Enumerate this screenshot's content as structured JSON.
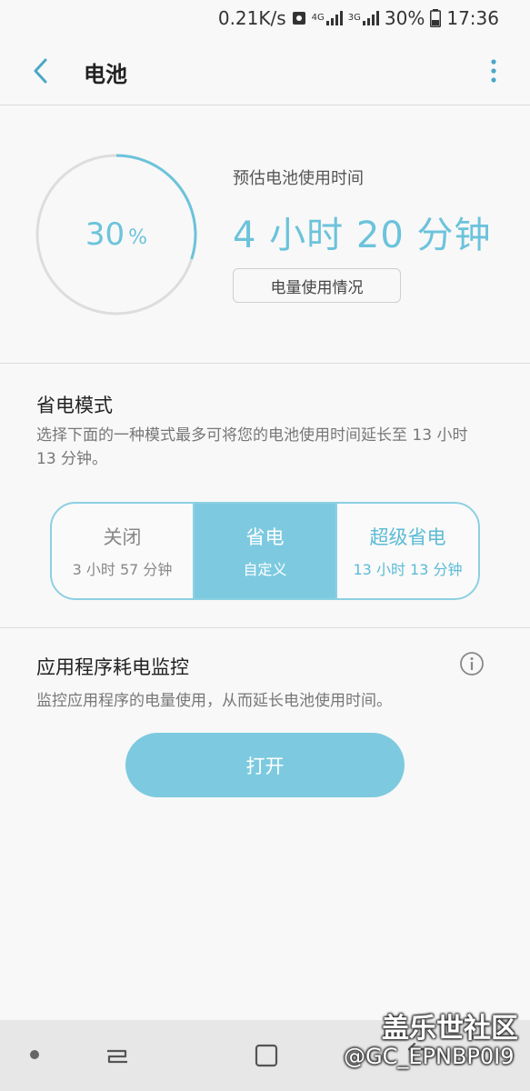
{
  "status_bar": {
    "speed": "0.21K/s",
    "network_label": "4G",
    "network_label_2": "3G",
    "battery_pct": "30%",
    "time": "17:36"
  },
  "header": {
    "title": "电池"
  },
  "battery": {
    "level_fraction": 0.3,
    "percent_value": "30",
    "percent_sign": "%",
    "estimate_label": "预估电池使用时间",
    "estimate_value": "4 小时 20 分钟",
    "usage_button": "电量使用情况"
  },
  "power_saving": {
    "title": "省电模式",
    "description": "选择下面的一种模式最多可将您的电池使用时间延长至 13 小时 13 分钟。",
    "modes": [
      {
        "name": "关闭",
        "sub": "3 小时 57 分钟"
      },
      {
        "name": "省电",
        "sub": "自定义"
      },
      {
        "name": "超级省电",
        "sub": "13 小时 13 分钟"
      }
    ],
    "selected_index": 1
  },
  "app_monitor": {
    "title": "应用程序耗电监控",
    "description": "监控应用程序的电量使用，从而延长电池使用时间。",
    "button": "打开"
  },
  "watermark": {
    "line1": "盖乐世社区",
    "line2": "@GC_EPNBP0I9"
  },
  "colors": {
    "accent": "#6cc3db",
    "accent_fill": "#7dcae0",
    "background": "#f8f8f8"
  }
}
